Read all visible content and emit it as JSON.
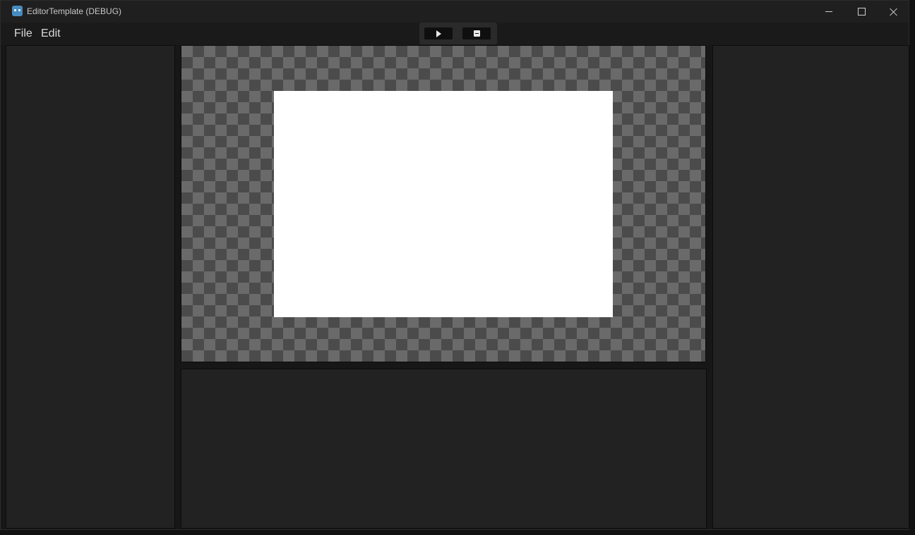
{
  "window": {
    "title": "EditorTemplate (DEBUG)",
    "app_icon": "godot-icon",
    "controls": {
      "minimize": "minimize-icon",
      "maximize": "maximize-icon",
      "close": "close-icon"
    }
  },
  "menubar": {
    "items": [
      {
        "label": "File"
      },
      {
        "label": "Edit"
      }
    ]
  },
  "toolbar": {
    "play_icon": "play-icon",
    "save_icon": "save-icon"
  },
  "colors": {
    "background": "#171717",
    "panel": "#222222",
    "checker_light": "#6a6a6a",
    "checker_dark": "#4b4b4b",
    "canvas": "#ffffff"
  }
}
